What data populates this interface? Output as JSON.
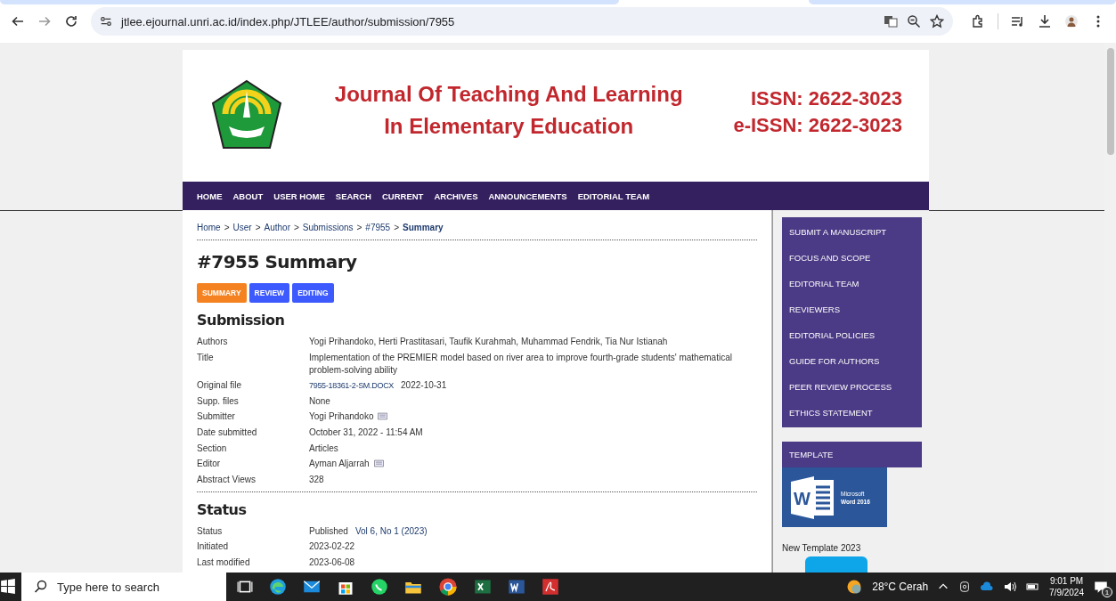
{
  "browser": {
    "url": "jtlee.ejournal.unri.ac.id/index.php/JTLEE/author/submission/7955"
  },
  "header": {
    "title_lines": [
      "Journal Of Teaching And Learning",
      "In Elementary Education"
    ],
    "issn_lines": [
      "ISSN: 2622-3023",
      "e-ISSN: 2622-3023"
    ]
  },
  "nav": [
    {
      "label": "HOME"
    },
    {
      "label": "ABOUT"
    },
    {
      "label": "USER HOME"
    },
    {
      "label": "SEARCH"
    },
    {
      "label": "CURRENT"
    },
    {
      "label": "ARCHIVES"
    },
    {
      "label": "ANNOUNCEMENTS"
    },
    {
      "label": "EDITORIAL TEAM"
    }
  ],
  "breadcrumb": [
    {
      "label": "Home",
      "current": false
    },
    {
      "label": "User",
      "current": false
    },
    {
      "label": "Author",
      "current": false
    },
    {
      "label": "Submissions",
      "current": false
    },
    {
      "label": "#7955",
      "current": false
    },
    {
      "label": "Summary",
      "current": true
    }
  ],
  "breadcrumb_separator": ">",
  "page_title": "#7955 Summary",
  "tabs": [
    {
      "label": "SUMMARY",
      "selected": true
    },
    {
      "label": "REVIEW",
      "selected": false
    },
    {
      "label": "EDITING",
      "selected": false
    }
  ],
  "sections": [
    {
      "heading": "Submission",
      "rows": [
        {
          "label": "Authors",
          "mail": false,
          "parts": [
            {
              "kind": "text",
              "text": "Yogi Prihandoko, Herti Prastitasari, Taufik Kurahmah, Muhammad Fendrik, Tia Nur Istianah"
            }
          ]
        },
        {
          "label": "Title",
          "mail": false,
          "parts": [
            {
              "kind": "text",
              "text": "Implementation of the PREMIER model based on river area to improve fourth-grade students' mathematical problem-solving ability"
            }
          ]
        },
        {
          "label": "Original file",
          "mail": false,
          "parts": [
            {
              "kind": "file",
              "text": "7955-18361-2-SM.DOCX"
            },
            {
              "kind": "text",
              "text": "2022-10-31"
            }
          ]
        },
        {
          "label": "Supp. files",
          "mail": false,
          "parts": [
            {
              "kind": "text",
              "text": "None"
            }
          ]
        },
        {
          "label": "Submitter",
          "mail": true,
          "parts": [
            {
              "kind": "text",
              "text": "Yogi Prihandoko"
            }
          ]
        },
        {
          "label": "Date submitted",
          "mail": false,
          "parts": [
            {
              "kind": "text",
              "text": "October 31, 2022 - 11:54 AM"
            }
          ]
        },
        {
          "label": "Section",
          "mail": false,
          "parts": [
            {
              "kind": "text",
              "text": "Articles"
            }
          ]
        },
        {
          "label": "Editor",
          "mail": true,
          "parts": [
            {
              "kind": "text",
              "text": "Ayman Aljarrah"
            }
          ]
        },
        {
          "label": "Abstract Views",
          "mail": false,
          "parts": [
            {
              "kind": "text",
              "text": "328"
            }
          ]
        }
      ]
    },
    {
      "heading": "Status",
      "rows": [
        {
          "label": "Status",
          "mail": false,
          "parts": [
            {
              "kind": "text",
              "text": "Published"
            },
            {
              "kind": "link",
              "text": "Vol 6, No 1 (2023)"
            }
          ]
        },
        {
          "label": "Initiated",
          "mail": false,
          "parts": [
            {
              "kind": "text",
              "text": "2023-02-22"
            }
          ]
        },
        {
          "label": "Last modified",
          "mail": false,
          "parts": [
            {
              "kind": "text",
              "text": "2023-06-08"
            }
          ]
        }
      ]
    }
  ],
  "sidebar": {
    "menu": [
      {
        "label": "SUBMIT A MANUSCRIPT"
      },
      {
        "label": "FOCUS AND SCOPE"
      },
      {
        "label": "EDITORIAL TEAM"
      },
      {
        "label": "REVIEWERS"
      },
      {
        "label": "EDITORIAL POLICIES"
      },
      {
        "label": "GUIDE FOR AUTHORS"
      },
      {
        "label": "PEER REVIEW PROCESS"
      },
      {
        "label": "ETHICS STATEMENT"
      }
    ],
    "template": {
      "heading": "TEMPLATE",
      "logo_letter": "W",
      "logo_lines": [
        "Microsoft",
        "Word 2016"
      ],
      "caption": "New Template 2023"
    }
  },
  "taskbar": {
    "search_placeholder": "Type here to search",
    "weather": "28°C  Cerah",
    "time": "9:01 PM",
    "date": "7/9/2024",
    "notification_count": "1"
  }
}
